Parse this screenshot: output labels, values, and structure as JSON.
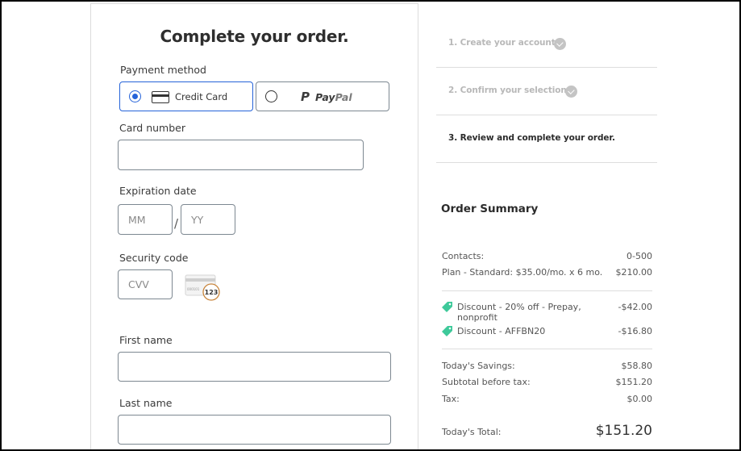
{
  "form": {
    "title": "Complete your order.",
    "payment_method_label": "Payment method",
    "payment_options": [
      {
        "label": "Credit Card",
        "selected": true,
        "icon": "credit-card-icon"
      },
      {
        "label_p": "P",
        "label_pay": "Pay",
        "label_pal": "Pal",
        "selected": false,
        "icon": "paypal-icon"
      }
    ],
    "card_number_label": "Card number",
    "card_number_value": "",
    "expiration_label": "Expiration date",
    "exp_month_placeholder": "MM",
    "exp_separator": "/",
    "exp_year_placeholder": "YY",
    "security_code_label": "Security code",
    "cvv_placeholder": "CVV",
    "cvv_hint_icon": "card-cvv-icon",
    "cvv_hint_number": "123",
    "cvv_hint_digits": "000101",
    "first_name_label": "First name",
    "first_name_value": "",
    "last_name_label": "Last name",
    "last_name_value": ""
  },
  "steps": [
    {
      "label": "1. Create your account.",
      "completed": true,
      "active": false
    },
    {
      "label": "2. Confirm your selection.",
      "completed": true,
      "active": false
    },
    {
      "label": "3. Review and complete your order.",
      "completed": false,
      "active": true
    }
  ],
  "summary": {
    "title": "Order Summary",
    "lines": [
      {
        "label": "Contacts:",
        "value": "0-500"
      },
      {
        "label": "Plan - Standard: $35.00/mo. x 6 mo.",
        "value": "$210.00"
      }
    ],
    "discounts": [
      {
        "label": "Discount - 20% off - Prepay, nonprofit",
        "value": "-$42.00",
        "icon": "tag-icon"
      },
      {
        "label": "Discount - AFFBN20",
        "value": "-$16.80",
        "icon": "tag-icon"
      }
    ],
    "totals": [
      {
        "label": "Today's Savings:",
        "value": "$58.80"
      },
      {
        "label": "Subtotal before tax:",
        "value": "$151.20"
      },
      {
        "label": "Tax:",
        "value": "$0.00"
      }
    ],
    "grand_total_label": "Today's Total:",
    "grand_total_value": "$151.20"
  },
  "colors": {
    "accent": "#2563d9",
    "tag": "#3ec99a",
    "cvv_ring": "#c8843a"
  }
}
